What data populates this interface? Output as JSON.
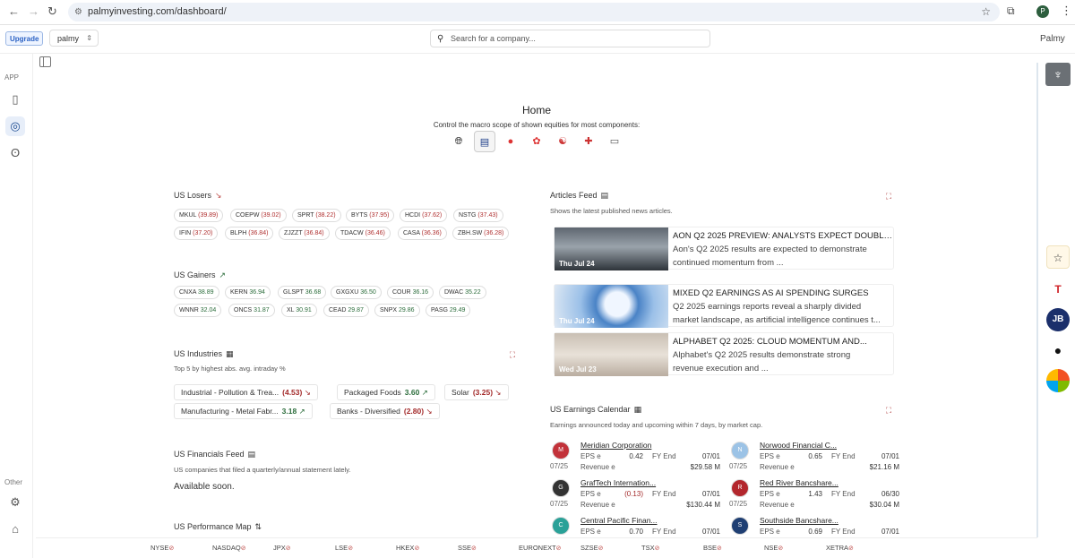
{
  "browser": {
    "url": "palmyinvesting.com/dashboard/",
    "profile_initial": "P"
  },
  "header": {
    "upgrade_label": "Upgrade",
    "workspace": "palmy",
    "search_placeholder": "Search for a company...",
    "brand": "Palmy"
  },
  "sidebar": {
    "app_label": "APP",
    "other_label": "Other"
  },
  "home": {
    "title": "Home",
    "subtitle": "Control the macro scope of shown equities for most components:"
  },
  "losers": {
    "title": "US Losers",
    "items": [
      {
        "ticker": "MKUL",
        "value": "(39.89)"
      },
      {
        "ticker": "COEPW",
        "value": "(39.02)"
      },
      {
        "ticker": "SPRT",
        "value": "(38.22)"
      },
      {
        "ticker": "BYTS",
        "value": "(37.95)"
      },
      {
        "ticker": "HCDI",
        "value": "(37.62)"
      },
      {
        "ticker": "NSTG",
        "value": "(37.43)"
      },
      {
        "ticker": "IFIN",
        "value": "(37.20)"
      },
      {
        "ticker": "BLPH",
        "value": "(36.84)"
      },
      {
        "ticker": "ZJZZT",
        "value": "(36.84)"
      },
      {
        "ticker": "TDACW",
        "value": "(36.46)"
      },
      {
        "ticker": "CASA",
        "value": "(36.36)"
      },
      {
        "ticker": "ZBH.SW",
        "value": "(36.28)"
      }
    ]
  },
  "gainers": {
    "title": "US Gainers",
    "items": [
      {
        "ticker": "CNXA",
        "value": "38.89"
      },
      {
        "ticker": "KERN",
        "value": "36.94"
      },
      {
        "ticker": "GLSPT",
        "value": "36.68"
      },
      {
        "ticker": "GXGXU",
        "value": "36.50"
      },
      {
        "ticker": "COUR",
        "value": "36.16"
      },
      {
        "ticker": "DWAC",
        "value": "35.22"
      },
      {
        "ticker": "WNNR",
        "value": "32.04"
      },
      {
        "ticker": "ONCS",
        "value": "31.87"
      },
      {
        "ticker": "XL",
        "value": "30.91"
      },
      {
        "ticker": "CEAD",
        "value": "29.87"
      },
      {
        "ticker": "SNPX",
        "value": "29.86"
      },
      {
        "ticker": "PASG",
        "value": "29.49"
      }
    ]
  },
  "industries": {
    "title": "US Industries",
    "subtitle": "Top 5 by highest abs. avg. intraday %",
    "items": [
      {
        "name": "Industrial - Pollution & Trea...",
        "value": "(4.53)",
        "dir": "down"
      },
      {
        "name": "Packaged Foods",
        "value": "3.60",
        "dir": "up"
      },
      {
        "name": "Solar",
        "value": "(3.25)",
        "dir": "down"
      },
      {
        "name": "Manufacturing - Metal Fabr...",
        "value": "3.18",
        "dir": "up"
      },
      {
        "name": "Banks - Diversified",
        "value": "(2.80)",
        "dir": "down"
      }
    ]
  },
  "financials": {
    "title": "US Financials Feed",
    "subtitle": "US companies that filed a quarterly/annual statement lately.",
    "body": "Available soon."
  },
  "perfmap": {
    "title": "US Performance Map"
  },
  "articles": {
    "title": "Articles Feed",
    "subtitle": "Shows the latest published news articles.",
    "items": [
      {
        "date": "Thu Jul 24",
        "headline": "AON Q2 2025 PREVIEW: ANALYSTS EXPECT DOUBLE-...",
        "line1": "Aon's Q2 2025 results are expected to demonstrate",
        "line2": "continued momentum from ..."
      },
      {
        "date": "Thu Jul 24",
        "headline": "MIXED Q2 EARNINGS AS AI SPENDING SURGES",
        "line1": "Q2 2025 earnings reports reveal a sharply divided",
        "line2": "market landscape, as artificial intelligence continues t..."
      },
      {
        "date": "Wed Jul 23",
        "headline": "ALPHABET Q2 2025: CLOUD MOMENTUM AND...",
        "line1": "Alphabet's Q2 2025 results demonstrate strong",
        "line2": "revenue execution and ..."
      }
    ]
  },
  "earnings": {
    "title": "US Earnings Calendar",
    "subtitle": "Earnings announced today and upcoming within 7 days, by market cap.",
    "eps_label": "EPS e",
    "rev_label": "Revenue e",
    "fy_label": "FY End",
    "items": [
      {
        "name": "Meridian Corporation",
        "date": "07/25",
        "eps": "0.42",
        "fy": "07/01",
        "rev": "$29.58 M",
        "color": "#c2323a",
        "logo": "M"
      },
      {
        "name": "Norwood Financial C...",
        "date": "07/25",
        "eps": "0.65",
        "fy": "07/01",
        "rev": "$21.16 M",
        "color": "#9cc3e6",
        "logo": "N"
      },
      {
        "name": "GrafTech Internation...",
        "date": "07/25",
        "eps": "(0.13)",
        "fy": "07/01",
        "rev": "$130.44 M",
        "color": "#333333",
        "logo": "G"
      },
      {
        "name": "Red River Bancshare...",
        "date": "07/25",
        "eps": "1.43",
        "fy": "06/30",
        "rev": "$30.04 M",
        "color": "#b3272d",
        "logo": "R"
      },
      {
        "name": "Central Pacific Finan...",
        "date": "",
        "eps": "0.70",
        "fy": "07/01",
        "rev": "",
        "color": "#2aa198",
        "logo": "C"
      },
      {
        "name": "Southside Bancshare...",
        "date": "",
        "eps": "0.69",
        "fy": "07/01",
        "rev": "",
        "color": "#1f3f73",
        "logo": "S"
      }
    ]
  },
  "exchanges": [
    "NYSE",
    "NASDAQ",
    "JPX",
    "LSE",
    "HKEX",
    "SSE",
    "EURONEXT",
    "SZSE",
    "TSX",
    "BSE",
    "NSE",
    "XETRA"
  ]
}
